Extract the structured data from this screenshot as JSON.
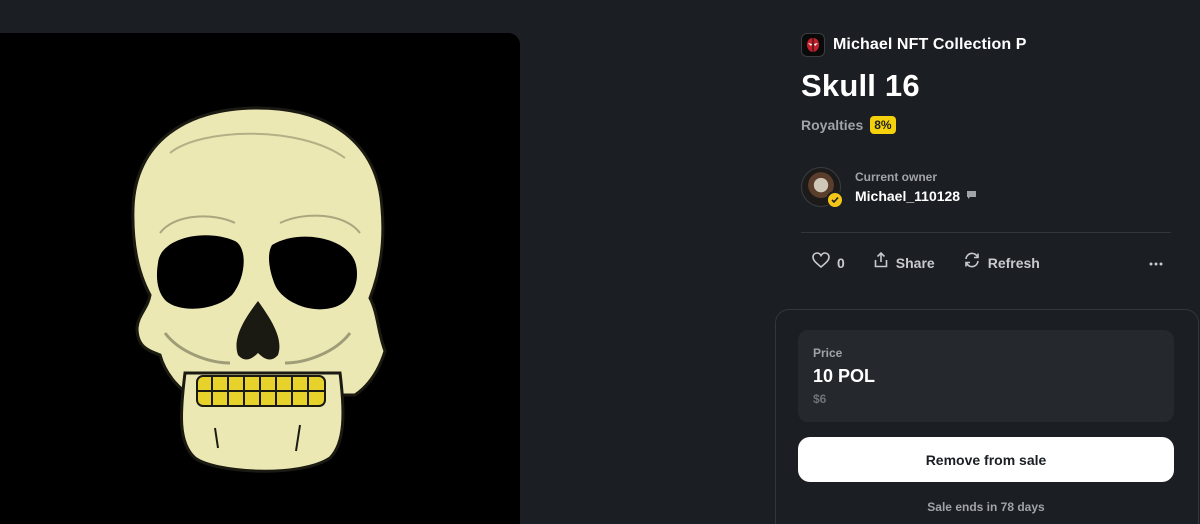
{
  "collection": {
    "name": "Michael NFT Collection P",
    "avatar_icon": "spider-mask-icon"
  },
  "item": {
    "title": "Skull 16"
  },
  "royalties": {
    "label": "Royalties",
    "value": "8%"
  },
  "owner": {
    "label": "Current owner",
    "name": "Michael_110128",
    "verified_icon": "verified-check-icon",
    "message_icon": "message-icon"
  },
  "actions": {
    "like_count": "0",
    "share_label": "Share",
    "refresh_label": "Refresh",
    "more_icon": "more-horizontal-icon"
  },
  "sale": {
    "price_label": "Price",
    "price_value": "10 POL",
    "price_fiat": "$6",
    "remove_button": "Remove from sale",
    "ends_text": "Sale ends in 78 days"
  },
  "colors": {
    "background": "#1b1e22",
    "accent_yellow": "#f5d10c",
    "card": "#25282d",
    "skull_bone": "#ece8b4",
    "teeth_gold": "#e6d22a"
  }
}
